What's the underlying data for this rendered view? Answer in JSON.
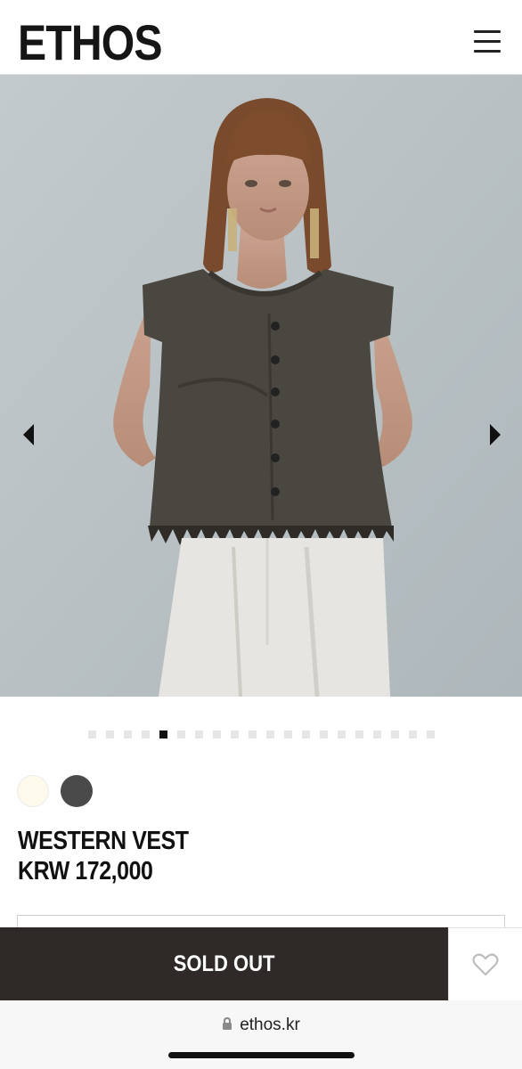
{
  "header": {
    "logo": "ETHOS",
    "menu_icon": "hamburger-menu-icon"
  },
  "gallery": {
    "image_description_icon": "product-photo",
    "prev_icon": "arrow-left-icon",
    "next_icon": "arrow-right-icon",
    "dot_count": 20,
    "active_index": 4
  },
  "colors": {
    "swatches": [
      {
        "name": "cream",
        "hex": "#fdfaec"
      },
      {
        "name": "charcoal",
        "hex": "#4a4a4a"
      }
    ],
    "action_bar": "#2f2a28"
  },
  "product": {
    "name": "WESTERN VEST",
    "price": "KRW 172,000"
  },
  "actions": {
    "sold_out_label": "SOLD OUT",
    "wishlist_icon": "heart-icon"
  },
  "browser": {
    "url": "ethos.kr",
    "lock_icon": "lock-icon"
  }
}
